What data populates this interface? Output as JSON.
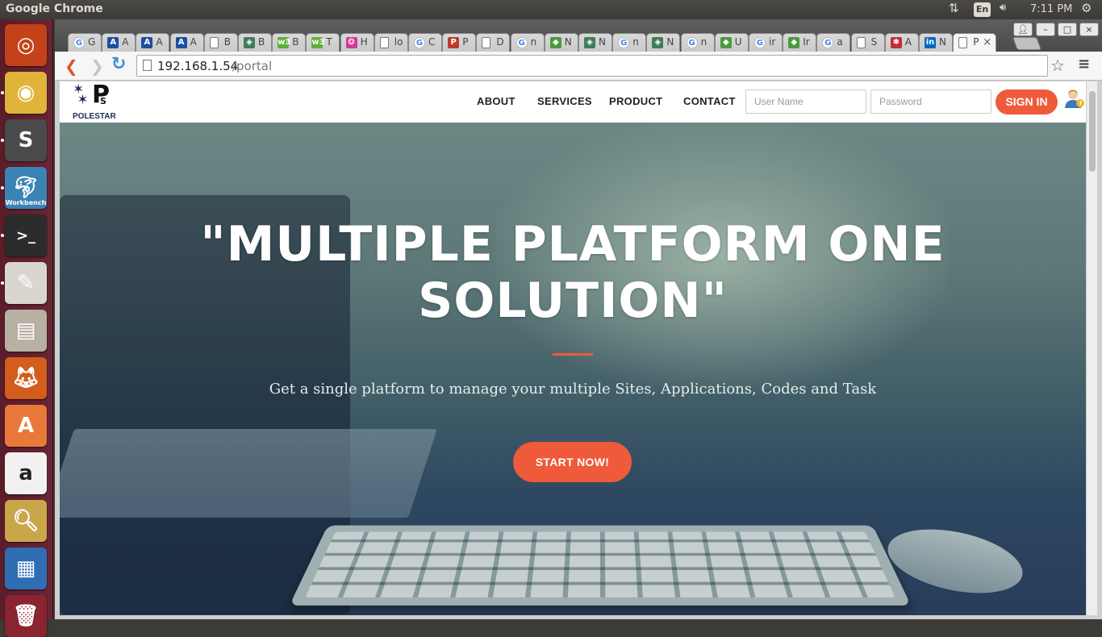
{
  "top_panel": {
    "app_title": "Google Chrome",
    "network_icon": "network-updown-icon",
    "keyboard_lang": "En",
    "volume_icon": "volume-icon",
    "time": "7:11 PM",
    "settings_icon": "gear-icon"
  },
  "launcher": {
    "items": [
      {
        "name": "ubuntu-dash",
        "icon": "ubuntu-logo-icon",
        "color": "#c44219"
      },
      {
        "name": "chrome",
        "icon": "chrome-icon",
        "color": "#e0b33a",
        "running": true
      },
      {
        "name": "sublime-text",
        "icon": "sublime-icon",
        "color": "#4a4a4a",
        "running": true
      },
      {
        "name": "mysql-workbench",
        "icon": "workbench-icon",
        "color": "#3b83b5",
        "label": "Workbench",
        "running": true
      },
      {
        "name": "terminal",
        "icon": "terminal-icon",
        "color": "#2c2c2c",
        "running": true
      },
      {
        "name": "text-editor",
        "icon": "text-editor-icon",
        "color": "#d9d6cf",
        "running": true
      },
      {
        "name": "file-manager",
        "icon": "file-cabinet-icon",
        "color": "#b8b0a3"
      },
      {
        "name": "firefox",
        "icon": "firefox-icon",
        "color": "#d25d1d"
      },
      {
        "name": "software-center",
        "icon": "shopping-bag-icon",
        "color": "#e8793a"
      },
      {
        "name": "amazon",
        "icon": "amazon-icon",
        "color": "#f1f1f1"
      },
      {
        "name": "image-viewer",
        "icon": "magnifier-photo-icon",
        "color": "#c9a64a"
      },
      {
        "name": "libreoffice-writer",
        "icon": "document-icon",
        "color": "#2f6eb3"
      },
      {
        "name": "trash",
        "icon": "trash-icon",
        "color": "#8a2431"
      }
    ]
  },
  "browser": {
    "tabs": [
      {
        "favicon": "google-icon",
        "label": "G",
        "color": "#4285f4"
      },
      {
        "favicon": "atlassian-icon",
        "label": "A",
        "color": "#1d4fa0"
      },
      {
        "favicon": "atlassian-icon",
        "label": "A",
        "color": "#1d4fa0"
      },
      {
        "favicon": "atlassian-icon",
        "label": "A",
        "color": "#1d4fa0"
      },
      {
        "favicon": "page-icon",
        "label": "B",
        "color": "#888888"
      },
      {
        "favicon": "diamond-icon",
        "label": "B",
        "color": "#3f7d5a"
      },
      {
        "favicon": "w3-icon",
        "label": "B",
        "color": "#5cb035"
      },
      {
        "favicon": "w3-icon",
        "label": "T",
        "color": "#5cb035"
      },
      {
        "favicon": "color-wheel-icon",
        "label": "H",
        "color": "#d33a8f"
      },
      {
        "favicon": "page-icon",
        "label": "lo",
        "color": "#888888"
      },
      {
        "favicon": "google-icon",
        "label": "C",
        "color": "#4285f4"
      },
      {
        "favicon": "pdf-icon",
        "label": "P",
        "color": "#c0392b"
      },
      {
        "favicon": "page-icon",
        "label": "D",
        "color": "#888888"
      },
      {
        "favicon": "google-icon",
        "label": "n",
        "color": "#4285f4"
      },
      {
        "favicon": "cube-icon",
        "label": "N",
        "color": "#4a9a3a"
      },
      {
        "favicon": "diamond-icon",
        "label": "N",
        "color": "#3f7d5a"
      },
      {
        "favicon": "google-icon",
        "label": "n",
        "color": "#4285f4"
      },
      {
        "favicon": "diamond-icon",
        "label": "N",
        "color": "#3f7d5a"
      },
      {
        "favicon": "google-icon",
        "label": "n",
        "color": "#4285f4"
      },
      {
        "favicon": "cube-icon",
        "label": "U",
        "color": "#4a9a3a"
      },
      {
        "favicon": "google-icon",
        "label": "ir",
        "color": "#4285f4"
      },
      {
        "favicon": "cube-icon",
        "label": "Ir",
        "color": "#4a9a3a"
      },
      {
        "favicon": "google-icon",
        "label": "a",
        "color": "#4285f4"
      },
      {
        "favicon": "page-icon",
        "label": "S",
        "color": "#888888"
      },
      {
        "favicon": "cluster-icon",
        "label": "A",
        "color": "#c62a3c"
      },
      {
        "favicon": "linkedin-icon",
        "label": "N",
        "color": "#0a66c2"
      },
      {
        "favicon": "page-icon",
        "label": "P",
        "color": "#888888",
        "active": true,
        "close": "×"
      }
    ],
    "window_controls": {
      "minimize": "–",
      "maximize": "□",
      "close": "×",
      "profile_icon": "profile-icon"
    },
    "back_icon": "back-arrow-icon",
    "forward_icon": "forward-arrow-icon",
    "reload_icon": "reload-icon",
    "url_host": "192.168.1.54",
    "url_path": "/portal",
    "star_icon": "bookmark-star-icon",
    "menu_icon": "hamburger-menu-icon"
  },
  "site": {
    "logo_text": "POLESTAR",
    "logo_letters": "P",
    "logo_sub": "S",
    "nav": [
      "ABOUT",
      "SERVICES",
      "PRODUCT",
      "CONTACT"
    ],
    "username_placeholder": "User Name",
    "password_placeholder": "Password",
    "signin_label": "SIGN IN",
    "user_help_icon": "user-help-icon",
    "accent_color": "#ef5a3a",
    "hero": {
      "title": "\"MULTIPLE PLATFORM ONE SOLUTION\"",
      "subtitle": "Get a single platform to manage your multiple Sites, Applications, Codes and Task",
      "cta_label": "START NOW!"
    }
  }
}
